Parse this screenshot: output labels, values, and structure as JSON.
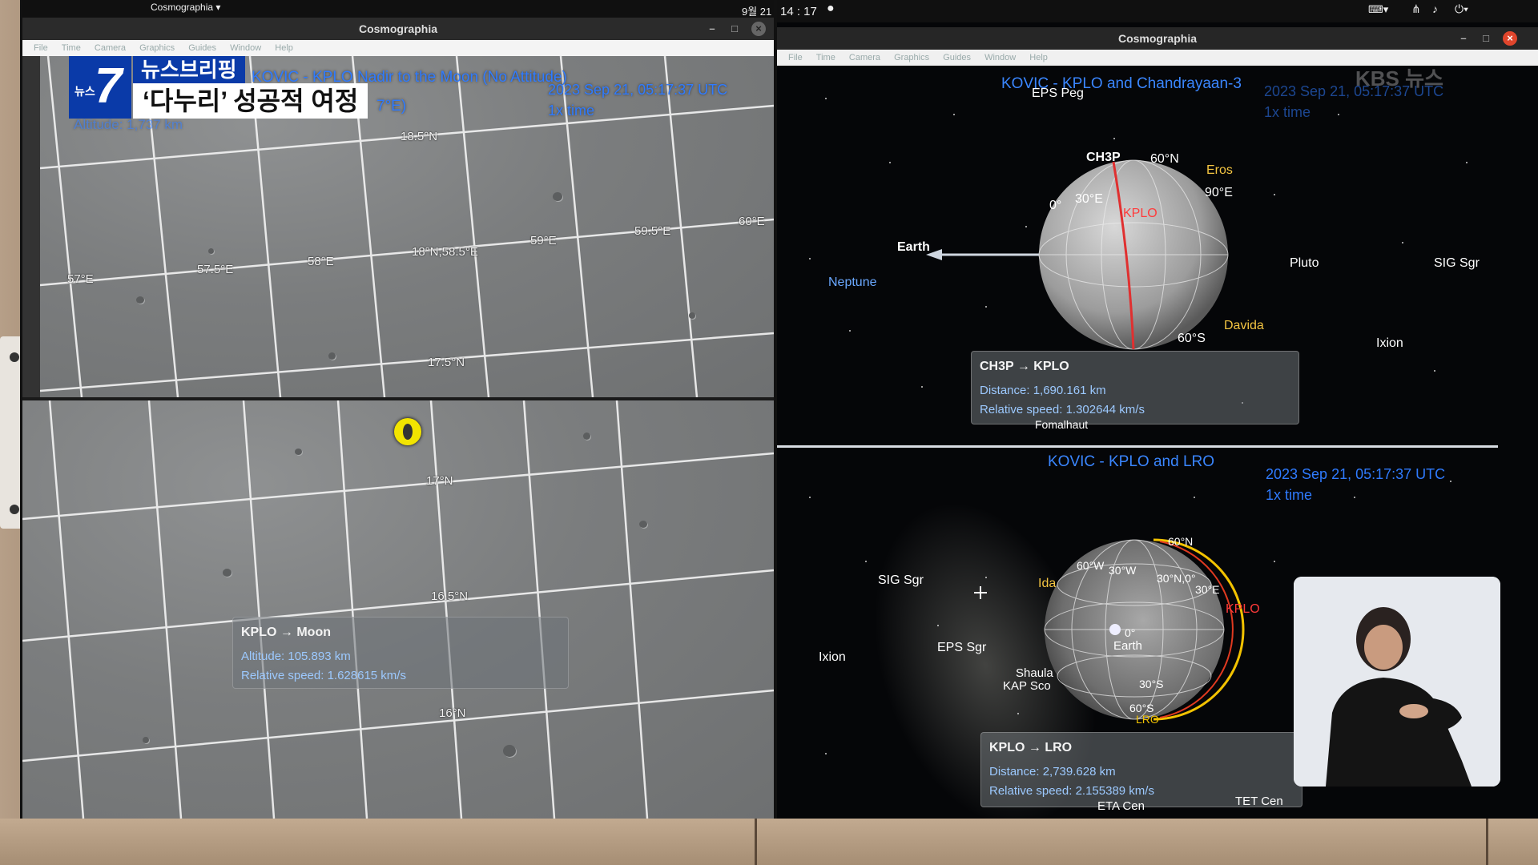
{
  "news": {
    "program_small": "뉴스",
    "program_number": "7",
    "segment": "뉴스브리핑",
    "headline": "‘다누리’ 성공적 여정"
  },
  "left_top": {
    "system_date": "9월 21",
    "app_menu": "Cosmographia ▾",
    "window_title": "Cosmographia",
    "menu": [
      "File",
      "Time",
      "Camera",
      "Graphics",
      "Guides",
      "Window",
      "Help"
    ],
    "view_title": "KOVIC - KPLO Nadir to the Moon (No Attitude)",
    "coords": "7°E)",
    "altitude_faint": "Altitude: 1,737 km",
    "timestamp": "2023 Sep 21, 05:17:37 UTC",
    "time_rate": "1x time",
    "grid": [
      "18.5°N",
      "57°E",
      "57.5°E",
      "58°E",
      "18°N,58.5°E",
      "59°E",
      "59.5°E",
      "60°E",
      "17.5°N"
    ]
  },
  "left_bottom": {
    "grid": [
      "17°N",
      "16.5°N",
      "16°N"
    ],
    "info": {
      "title": "KPLO → Moon",
      "altitude": "Altitude: 105.893 km",
      "speed": "Relative speed: 1.628615 km/s"
    }
  },
  "right_top": {
    "system_time": "14 : 17",
    "window_title": "Cosmographia",
    "menu": [
      "File",
      "Time",
      "Camera",
      "Graphics",
      "Guides",
      "Window",
      "Help"
    ],
    "view_title": "KOVIC - KPLO and Chandrayaan-3",
    "timestamp": "2023 Sep 21, 05:17:37 UTC",
    "time_rate": "1x time",
    "watermark": "KBS 뉴스",
    "labels": {
      "eps_peg": "EPS Peg",
      "ch3p": "CH3P",
      "lat60n": "60°N",
      "eros": "Eros",
      "lon90e": "90°E",
      "lon30e": "30°E",
      "lon0": "0°",
      "kplo": "KPLO",
      "earth": "Earth",
      "neptune": "Neptune",
      "pluto": "Pluto",
      "sig_sgr": "SIG Sgr",
      "davida": "Davida",
      "ixion": "Ixion",
      "lat60s": "60°S",
      "fomalhaut": "Fomalhaut"
    },
    "info": {
      "title": "CH3P → KPLO",
      "distance": "Distance: 1,690.161 km",
      "speed": "Relative speed: 1.302644 km/s"
    }
  },
  "right_bottom": {
    "view_title": "KOVIC - KPLO and LRO",
    "timestamp": "2023 Sep 21, 05:17:37 UTC",
    "time_rate": "1x time",
    "labels": {
      "sig_sgr": "SIG Sgr",
      "ida": "Ida",
      "lat60n": "60°N",
      "lon60w": "60°W",
      "lon30w": "30°W",
      "lat30n": "30°N,0°",
      "lon30e": "30°E",
      "kplo": "KPLO",
      "ixion": "Ixion",
      "eps_sgr": "EPS Sgr",
      "lon0": "0°",
      "earth": "Earth",
      "shaula": "Shaula",
      "kap_sco": "KAP Sco",
      "lat30s": "30°S",
      "lat60s": "60°S",
      "lro": "LRO",
      "eta_cen": "ETA Cen",
      "tet_cen": "TET Cen"
    },
    "info": {
      "title": "KPLO → LRO",
      "distance": "Distance: 2,739.628 km",
      "speed": "Relative speed: 2.155389 km/s"
    }
  }
}
